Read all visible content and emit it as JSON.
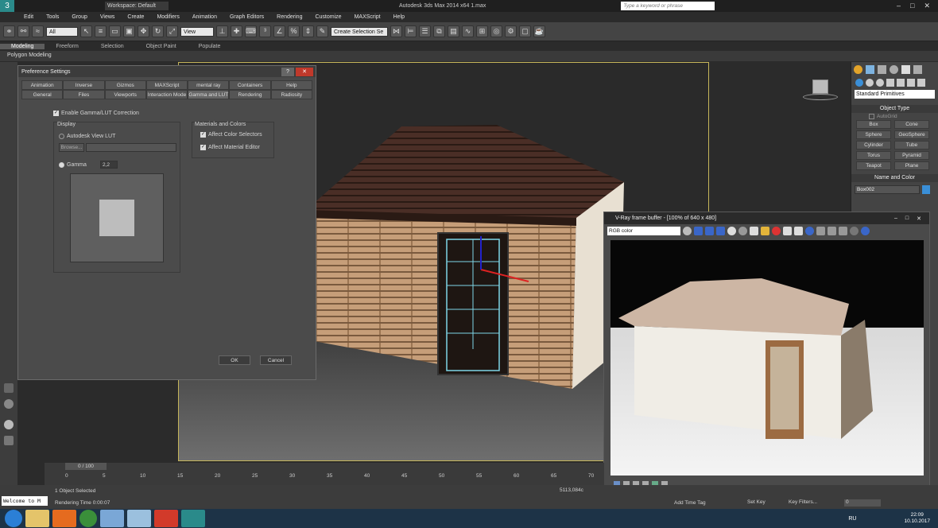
{
  "window": {
    "title": "Autodesk 3ds Max  2014 x64     1.max",
    "workspace": "Workspace: Default",
    "search_placeholder": "Type a keyword or phrase"
  },
  "menu": [
    "Edit",
    "Tools",
    "Group",
    "Views",
    "Create",
    "Modifiers",
    "Animation",
    "Graph Editors",
    "Rendering",
    "Customize",
    "MAXScript",
    "Help"
  ],
  "toolbar": {
    "filter": "All",
    "view": "View",
    "selection_set": "Create Selection Se"
  },
  "ribbon": {
    "tabs": [
      "Modeling",
      "Freeform",
      "Selection",
      "Object Paint",
      "Populate"
    ],
    "sub": "Polygon Modeling"
  },
  "pref": {
    "title": "Preference Settings",
    "tabs_row1": [
      "Animation",
      "Inverse Kinematics",
      "Gizmos",
      "MAXScript",
      "mental ray",
      "Containers",
      "Help"
    ],
    "tabs_row2": [
      "General",
      "Files",
      "Viewports",
      "Interaction Mode",
      "Gamma and LUT",
      "Rendering",
      "Radiosity"
    ],
    "enable": "Enable Gamma/LUT Correction",
    "display_group": "Display",
    "lut_label": "Autodesk View LUT",
    "browse": "Browse...",
    "gamma_label": "Gamma",
    "gamma_value": "2,2",
    "materials_group": "Materials and Colors",
    "affect_color": "Affect Color Selectors",
    "affect_material": "Affect Material Editor",
    "ok": "OK",
    "cancel": "Cancel"
  },
  "right_panel": {
    "category": "Standard Primitives",
    "object_type": "Object Type",
    "autogrid": "AutoGrid",
    "objects": [
      "Box",
      "Cone",
      "Sphere",
      "GeoSphere",
      "Cylinder",
      "Tube",
      "Torus",
      "Pyramid",
      "Teapot",
      "Plane"
    ],
    "name_color": "Name and Color",
    "object_name": "Box002",
    "color": "#3a8fd8"
  },
  "vfb": {
    "title": "V-Ray frame buffer - [100% of 640 x 480]",
    "channel": "RGB color"
  },
  "timeline": {
    "frame": "0 / 100",
    "ticks": [
      "0",
      "5",
      "10",
      "15",
      "20",
      "25",
      "30",
      "35",
      "40",
      "45",
      "50",
      "55",
      "60",
      "65",
      "70"
    ]
  },
  "status": {
    "selected": "1 Object Selected",
    "render_time": "Rendering Time  0:00:07",
    "coord": "5113,084c",
    "welcome": "Welcome to M",
    "add_time_tag": "Add Time Tag",
    "set_key": "Set Key",
    "key_filters": "Key Filters...",
    "frame_field": "0"
  },
  "taskbar": {
    "lang": "RU",
    "time": "22:09",
    "date": "10.10.2017"
  }
}
